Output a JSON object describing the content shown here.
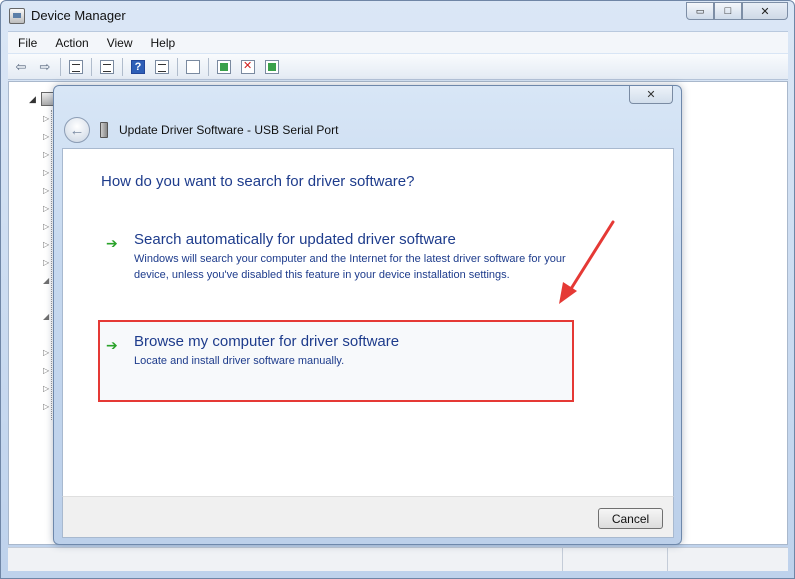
{
  "window": {
    "title": "Device Manager",
    "controls": {
      "minimize": "▭",
      "maximize": "□",
      "close": "✕"
    }
  },
  "menubar": {
    "items": [
      "File",
      "Action",
      "View",
      "Help"
    ]
  },
  "toolbar": {
    "icons": [
      "back-arrow-icon",
      "forward-arrow-icon",
      "show-hide-console-tree-icon",
      "properties-icon",
      "help-icon",
      "view-icon",
      "scan-hardware-icon",
      "update-driver-icon",
      "uninstall-icon",
      "disable-device-icon"
    ]
  },
  "dialog": {
    "title": "Update Driver Software - USB Serial Port",
    "question": "How do you want to search for driver software?",
    "options": [
      {
        "title": "Search automatically for updated driver software",
        "description": "Windows will search your computer and the Internet for the latest driver software for your device, unless you've disabled this feature in your device installation settings."
      },
      {
        "title": "Browse my computer for driver software",
        "description": "Locate and install driver software manually."
      }
    ],
    "cancel_label": "Cancel",
    "close_glyph": "✕"
  },
  "colors": {
    "link_blue": "#1e3c8c",
    "highlight_red": "#e53935",
    "arrow_green": "#2aa32a"
  }
}
